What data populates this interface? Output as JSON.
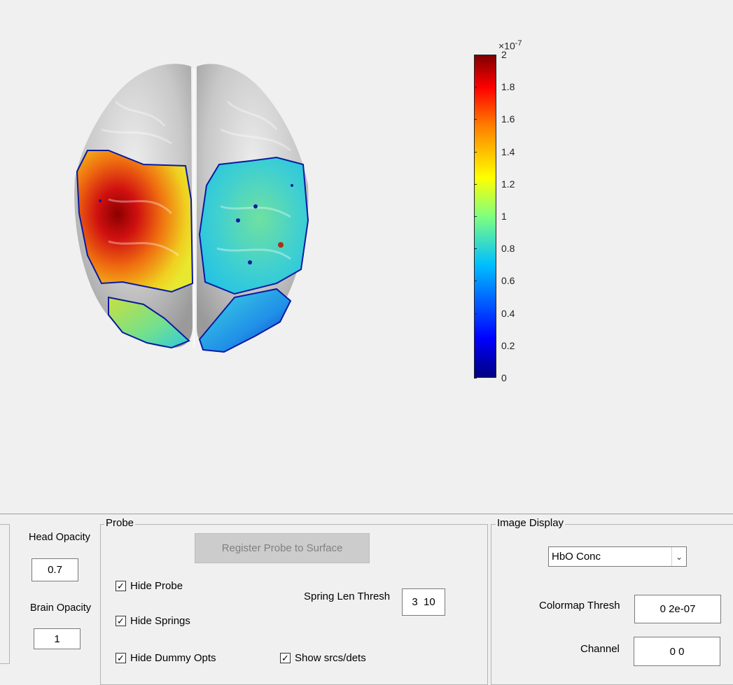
{
  "colorbar": {
    "exponent_base": "×10",
    "exponent_power": "-7",
    "ticks": [
      "2",
      "1.8",
      "1.6",
      "1.4",
      "1.2",
      "1",
      "0.8",
      "0.6",
      "0.4",
      "0.2",
      "0"
    ],
    "range": [
      0,
      2
    ],
    "colormap": "jet"
  },
  "brain": {
    "surface_color": "#c8c8c8",
    "left_region_level": 1.7,
    "right_region_level": 0.8,
    "lower_left_region_level": 1.0,
    "lower_right_region_level": 0.4
  },
  "head_panel": {
    "head_opacity_label": "Head Opacity",
    "head_opacity_value": "0.7",
    "brain_opacity_label": "Brain Opacity",
    "brain_opacity_value": "1"
  },
  "probe_panel": {
    "title": "Probe",
    "register_button": "Register Probe to Surface",
    "hide_probe": {
      "label": "Hide Probe",
      "checked": true
    },
    "hide_springs": {
      "label": "Hide Springs",
      "checked": true
    },
    "hide_dummy_opts": {
      "label": "Hide Dummy Opts",
      "checked": true
    },
    "show_srcs_dets": {
      "label": "Show srcs/dets",
      "checked": true
    },
    "spring_len_thresh_label": "Spring Len Thresh",
    "spring_len_thresh_value": "3  10"
  },
  "image_display_panel": {
    "title": "Image Display",
    "display_select": "HbO Conc",
    "colormap_thresh_label": "Colormap Thresh",
    "colormap_thresh_value": "0 2e-07",
    "channel_label": "Channel",
    "channel_value": "0 0"
  }
}
